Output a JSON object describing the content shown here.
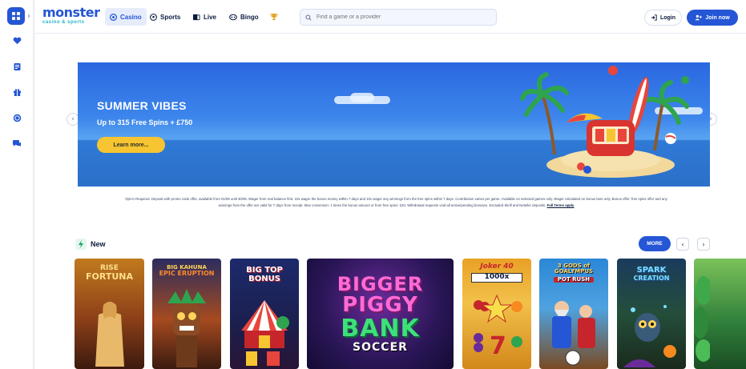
{
  "brand": {
    "logo_main": "monster",
    "logo_sub": "casino & sports",
    "accent": "#2456d6"
  },
  "nav": {
    "casino": "Casino",
    "sports": "Sports",
    "live": "Live",
    "bingo": "Bingo"
  },
  "search": {
    "placeholder": "Find a game or a provider"
  },
  "auth": {
    "login": "Login",
    "join": "Join now"
  },
  "rail": {
    "icons": [
      "favorites-icon",
      "receipt-icon",
      "gift-icon",
      "coin-icon",
      "chat-icon"
    ]
  },
  "banner": {
    "title": "SUMMER VIBES",
    "subtitle": "Up to 315 Free Spins + £750",
    "button": "Learn more...",
    "terms_line1": "Opt-in Required. Deposit with promo code offer, available from 01/06 until 30/06. Wager from real balance first. 10x wager the bonus money within 7 days and 10x wager any winnings from the free spins within 7 days. Contribution varies per game. Available on selected games only. Wager calculated on bonus bets only. Bonus offer: free spins offer and any",
    "terms_line2": "winnings from the offer are valid for 7 days from receipt. Max conversion: 1 times the bonus amount or from free spins: £20. Withdrawal requests void all active/pending bonuses. Excluded Skrill and Neteller deposits.",
    "terms_link": "Full Terms apply"
  },
  "new_section": {
    "title": "New",
    "more": "MORE",
    "games": [
      {
        "name": "Rise of Fortuna",
        "line1": "RISE",
        "line2": "FORTUNA"
      },
      {
        "name": "Big Kahuna Epic Eruption",
        "line1": "BIG KAHUNA",
        "line2": "EPIC ERUPTION"
      },
      {
        "name": "Big Top Bonus",
        "line1": "BIG TOP",
        "line2": "BONUS"
      },
      {
        "name": "Bigger Piggy Bank Soccer",
        "line1": "BIGGER",
        "line2": "PIGGY",
        "line3": "BANK",
        "line4": "SOCCER"
      },
      {
        "name": "Joker 40 1000x",
        "line1": "Joker 40",
        "line2": "1000x"
      },
      {
        "name": "3 Gods of Goalympus Pot Rush",
        "line1": "3 GODS of GOALYMPUS",
        "line2": "POT RUSH"
      },
      {
        "name": "Spark Creation",
        "line1": "SPARK",
        "line2": "CREATION"
      }
    ]
  }
}
